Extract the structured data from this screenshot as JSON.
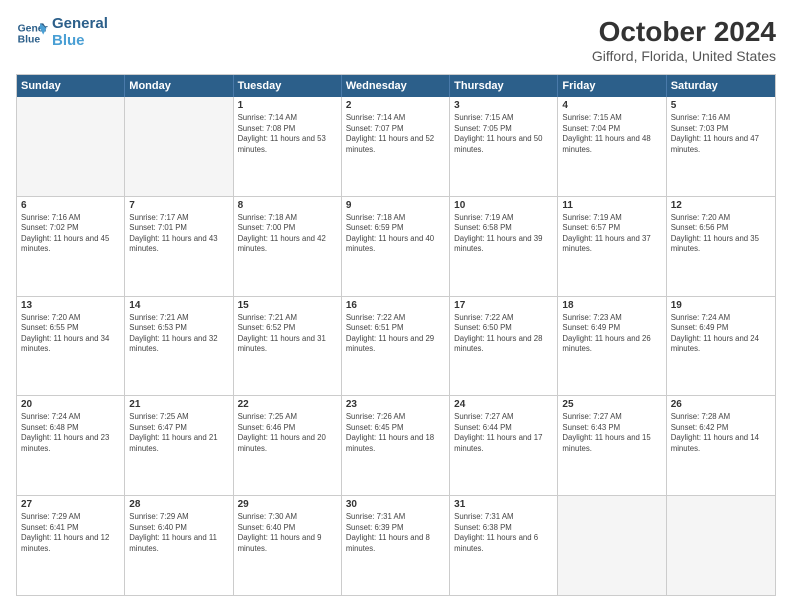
{
  "logo": {
    "line1": "General",
    "line2": "Blue"
  },
  "title": "October 2024",
  "subtitle": "Gifford, Florida, United States",
  "days": [
    "Sunday",
    "Monday",
    "Tuesday",
    "Wednesday",
    "Thursday",
    "Friday",
    "Saturday"
  ],
  "weeks": [
    [
      {
        "day": "",
        "info": ""
      },
      {
        "day": "",
        "info": ""
      },
      {
        "day": "1",
        "info": "Sunrise: 7:14 AM\nSunset: 7:08 PM\nDaylight: 11 hours and 53 minutes."
      },
      {
        "day": "2",
        "info": "Sunrise: 7:14 AM\nSunset: 7:07 PM\nDaylight: 11 hours and 52 minutes."
      },
      {
        "day": "3",
        "info": "Sunrise: 7:15 AM\nSunset: 7:05 PM\nDaylight: 11 hours and 50 minutes."
      },
      {
        "day": "4",
        "info": "Sunrise: 7:15 AM\nSunset: 7:04 PM\nDaylight: 11 hours and 48 minutes."
      },
      {
        "day": "5",
        "info": "Sunrise: 7:16 AM\nSunset: 7:03 PM\nDaylight: 11 hours and 47 minutes."
      }
    ],
    [
      {
        "day": "6",
        "info": "Sunrise: 7:16 AM\nSunset: 7:02 PM\nDaylight: 11 hours and 45 minutes."
      },
      {
        "day": "7",
        "info": "Sunrise: 7:17 AM\nSunset: 7:01 PM\nDaylight: 11 hours and 43 minutes."
      },
      {
        "day": "8",
        "info": "Sunrise: 7:18 AM\nSunset: 7:00 PM\nDaylight: 11 hours and 42 minutes."
      },
      {
        "day": "9",
        "info": "Sunrise: 7:18 AM\nSunset: 6:59 PM\nDaylight: 11 hours and 40 minutes."
      },
      {
        "day": "10",
        "info": "Sunrise: 7:19 AM\nSunset: 6:58 PM\nDaylight: 11 hours and 39 minutes."
      },
      {
        "day": "11",
        "info": "Sunrise: 7:19 AM\nSunset: 6:57 PM\nDaylight: 11 hours and 37 minutes."
      },
      {
        "day": "12",
        "info": "Sunrise: 7:20 AM\nSunset: 6:56 PM\nDaylight: 11 hours and 35 minutes."
      }
    ],
    [
      {
        "day": "13",
        "info": "Sunrise: 7:20 AM\nSunset: 6:55 PM\nDaylight: 11 hours and 34 minutes."
      },
      {
        "day": "14",
        "info": "Sunrise: 7:21 AM\nSunset: 6:53 PM\nDaylight: 11 hours and 32 minutes."
      },
      {
        "day": "15",
        "info": "Sunrise: 7:21 AM\nSunset: 6:52 PM\nDaylight: 11 hours and 31 minutes."
      },
      {
        "day": "16",
        "info": "Sunrise: 7:22 AM\nSunset: 6:51 PM\nDaylight: 11 hours and 29 minutes."
      },
      {
        "day": "17",
        "info": "Sunrise: 7:22 AM\nSunset: 6:50 PM\nDaylight: 11 hours and 28 minutes."
      },
      {
        "day": "18",
        "info": "Sunrise: 7:23 AM\nSunset: 6:49 PM\nDaylight: 11 hours and 26 minutes."
      },
      {
        "day": "19",
        "info": "Sunrise: 7:24 AM\nSunset: 6:49 PM\nDaylight: 11 hours and 24 minutes."
      }
    ],
    [
      {
        "day": "20",
        "info": "Sunrise: 7:24 AM\nSunset: 6:48 PM\nDaylight: 11 hours and 23 minutes."
      },
      {
        "day": "21",
        "info": "Sunrise: 7:25 AM\nSunset: 6:47 PM\nDaylight: 11 hours and 21 minutes."
      },
      {
        "day": "22",
        "info": "Sunrise: 7:25 AM\nSunset: 6:46 PM\nDaylight: 11 hours and 20 minutes."
      },
      {
        "day": "23",
        "info": "Sunrise: 7:26 AM\nSunset: 6:45 PM\nDaylight: 11 hours and 18 minutes."
      },
      {
        "day": "24",
        "info": "Sunrise: 7:27 AM\nSunset: 6:44 PM\nDaylight: 11 hours and 17 minutes."
      },
      {
        "day": "25",
        "info": "Sunrise: 7:27 AM\nSunset: 6:43 PM\nDaylight: 11 hours and 15 minutes."
      },
      {
        "day": "26",
        "info": "Sunrise: 7:28 AM\nSunset: 6:42 PM\nDaylight: 11 hours and 14 minutes."
      }
    ],
    [
      {
        "day": "27",
        "info": "Sunrise: 7:29 AM\nSunset: 6:41 PM\nDaylight: 11 hours and 12 minutes."
      },
      {
        "day": "28",
        "info": "Sunrise: 7:29 AM\nSunset: 6:40 PM\nDaylight: 11 hours and 11 minutes."
      },
      {
        "day": "29",
        "info": "Sunrise: 7:30 AM\nSunset: 6:40 PM\nDaylight: 11 hours and 9 minutes."
      },
      {
        "day": "30",
        "info": "Sunrise: 7:31 AM\nSunset: 6:39 PM\nDaylight: 11 hours and 8 minutes."
      },
      {
        "day": "31",
        "info": "Sunrise: 7:31 AM\nSunset: 6:38 PM\nDaylight: 11 hours and 6 minutes."
      },
      {
        "day": "",
        "info": ""
      },
      {
        "day": "",
        "info": ""
      }
    ]
  ]
}
